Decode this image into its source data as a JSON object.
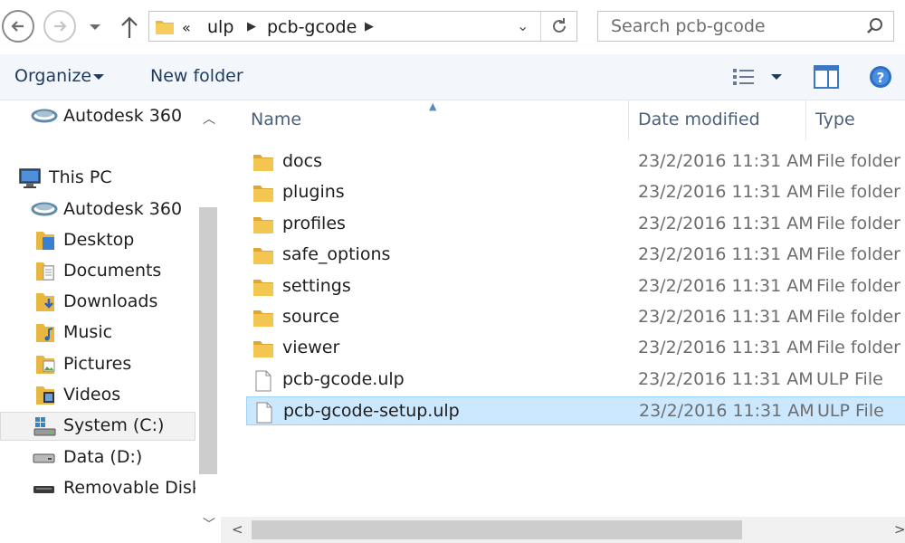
{
  "address": {
    "overflow": "«",
    "breadcrumbs": [
      "ulp",
      "pcb-gcode"
    ]
  },
  "search": {
    "placeholder": "Search pcb-gcode"
  },
  "toolbar": {
    "organize": "Organize",
    "new_folder": "New folder"
  },
  "nav": {
    "items": [
      {
        "label": "Autodesk 360",
        "icon": "autodesk-360-icon"
      },
      {
        "label": "This PC",
        "icon": "this-pc-icon"
      },
      {
        "label": "Autodesk 360",
        "icon": "autodesk-360-icon"
      },
      {
        "label": "Desktop",
        "icon": "desktop-folder-icon"
      },
      {
        "label": "Documents",
        "icon": "documents-folder-icon"
      },
      {
        "label": "Downloads",
        "icon": "downloads-folder-icon"
      },
      {
        "label": "Music",
        "icon": "music-folder-icon"
      },
      {
        "label": "Pictures",
        "icon": "pictures-folder-icon"
      },
      {
        "label": "Videos",
        "icon": "videos-folder-icon"
      },
      {
        "label": "System (C:)",
        "icon": "system-drive-icon"
      },
      {
        "label": "Data (D:)",
        "icon": "drive-icon"
      },
      {
        "label": "Removable Disk (",
        "icon": "removable-disk-icon"
      }
    ]
  },
  "columns": {
    "name": "Name",
    "date": "Date modified",
    "type": "Type"
  },
  "files": [
    {
      "name": "docs",
      "date": "23/2/2016 11:31 AM",
      "type": "File folder",
      "icon": "folder-icon"
    },
    {
      "name": "plugins",
      "date": "23/2/2016 11:31 AM",
      "type": "File folder",
      "icon": "folder-icon"
    },
    {
      "name": "profiles",
      "date": "23/2/2016 11:31 AM",
      "type": "File folder",
      "icon": "folder-icon"
    },
    {
      "name": "safe_options",
      "date": "23/2/2016 11:31 AM",
      "type": "File folder",
      "icon": "folder-icon"
    },
    {
      "name": "settings",
      "date": "23/2/2016 11:31 AM",
      "type": "File folder",
      "icon": "folder-icon"
    },
    {
      "name": "source",
      "date": "23/2/2016 11:31 AM",
      "type": "File folder",
      "icon": "folder-icon"
    },
    {
      "name": "viewer",
      "date": "23/2/2016 11:31 AM",
      "type": "File folder",
      "icon": "folder-icon"
    },
    {
      "name": "pcb-gcode.ulp",
      "date": "23/2/2016 11:31 AM",
      "type": "ULP File",
      "icon": "file-icon"
    },
    {
      "name": "pcb-gcode-setup.ulp",
      "date": "23/2/2016 11:31 AM",
      "type": "ULP File",
      "icon": "file-icon",
      "selected": true
    }
  ],
  "colors": {
    "accent": "#1e3a5f",
    "selection": "#cce8ff",
    "selection_border": "#99d1ff",
    "folder": "#e8b73f"
  }
}
